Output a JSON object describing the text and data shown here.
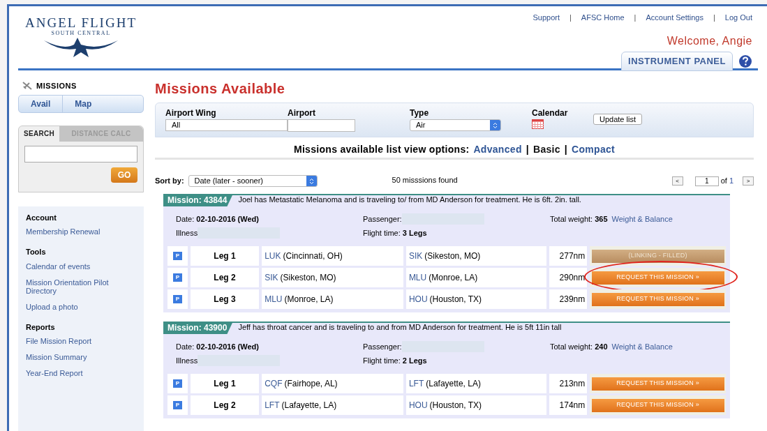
{
  "logo": {
    "title": "ANGEL FLIGHT",
    "subtitle": "SOUTH CENTRAL"
  },
  "top_links": [
    "Support",
    "AFSC Home",
    "Account Settings",
    "Log Out"
  ],
  "top_link_separator": "|",
  "welcome": "Welcome, Angie",
  "instrument_panel": "INSTRUMENT PANEL",
  "sidebar": {
    "heading": "MISSIONS",
    "nav_tabs": [
      {
        "label": "Avail"
      },
      {
        "label": "Map"
      }
    ],
    "search_tabs": [
      {
        "label": "SEARCH",
        "selected": true
      },
      {
        "label": "DISTANCE CALC",
        "selected": false
      }
    ],
    "go": "GO",
    "sections": [
      {
        "heading": "Account",
        "items": [
          "Membership Renewal"
        ]
      },
      {
        "heading": "Tools",
        "items": [
          "Calendar of events",
          "Mission Orientation Pilot Directory",
          "Upload a photo"
        ]
      },
      {
        "heading": "Reports",
        "items": [
          "File Mission Report",
          "Mission Summary",
          "Year-End Report"
        ]
      }
    ]
  },
  "title": "Missions Available",
  "filters": {
    "airport_wing": {
      "label": "Airport Wing",
      "value": "All"
    },
    "airport": {
      "label": "Airport"
    },
    "type": {
      "label": "Type",
      "value": "Air"
    },
    "calendar": {
      "label": "Calendar"
    },
    "update": "Update list"
  },
  "view_options": {
    "label": "Missions available list view options:",
    "separator": "|",
    "options": [
      {
        "label": "Advanced",
        "selected": false
      },
      {
        "label": "Basic",
        "selected": true
      },
      {
        "label": "Compact",
        "selected": false
      }
    ]
  },
  "sort": {
    "label": "Sort by:",
    "value": "Date (later - sooner)"
  },
  "found": "50 misssions found",
  "pager": {
    "prev": "<",
    "page": "1",
    "of": "of",
    "total": "1",
    "next": ">"
  },
  "missions": [
    {
      "title": "Mission: 43844",
      "description": "Joel has Metastatic Melanoma and is traveling to/ from MD Anderson for treatment. He is 6ft. 2in. tall.",
      "date_label": "Date:",
      "date": "02-10-2016 (Wed)",
      "passenger_label": "Passenger:",
      "weight_label": "Total weight:",
      "weight": "365",
      "weight_link": "Weight & Balance",
      "illness_label": "Illness",
      "flight_label": "Flight time:",
      "flight_time": "3 Legs",
      "legs": [
        {
          "badge": "P",
          "label": "Leg 1",
          "from_code": "LUK",
          "from_city": "(Cincinnati, OH)",
          "to_code": "SIK",
          "to_city": "(Sikeston, MO)",
          "distance": "277nm",
          "action": {
            "kind": "filled",
            "label": "(LINKING - FILLED)"
          },
          "highlighted": false
        },
        {
          "badge": "P",
          "label": "Leg 2",
          "from_code": "SIK",
          "from_city": "(Sikeston, MO)",
          "to_code": "MLU",
          "to_city": "(Monroe, LA)",
          "distance": "290nm",
          "action": {
            "kind": "request",
            "label": "REQUEST THIS MISSION »"
          },
          "highlighted": true
        },
        {
          "badge": "P",
          "label": "Leg 3",
          "from_code": "MLU",
          "from_city": "(Monroe, LA)",
          "to_code": "HOU",
          "to_city": "(Houston, TX)",
          "distance": "239nm",
          "action": {
            "kind": "request",
            "label": "REQUEST THIS MISSION »"
          },
          "highlighted": false
        }
      ]
    },
    {
      "title": "Mission: 43900",
      "description": "Jeff has throat cancer and is traveling to and from MD Anderson for treatment. He is 5ft 11in tall",
      "date_label": "Date:",
      "date": "02-10-2016 (Wed)",
      "passenger_label": "Passenger:",
      "weight_label": "Total weight:",
      "weight": "240",
      "weight_link": "Weight & Balance",
      "illness_label": "Illness",
      "flight_label": "Flight time:",
      "flight_time": "2 Legs",
      "legs": [
        {
          "badge": "P",
          "label": "Leg 1",
          "from_code": "CQF",
          "from_city": "(Fairhope, AL)",
          "to_code": "LFT",
          "to_city": "(Lafayette, LA)",
          "distance": "213nm",
          "action": {
            "kind": "request",
            "label": "REQUEST THIS MISSION »"
          },
          "highlighted": false
        },
        {
          "badge": "P",
          "label": "Leg 2",
          "from_code": "LFT",
          "from_city": "(Lafayette, LA)",
          "to_code": "HOU",
          "to_city": "(Houston, TX)",
          "distance": "174nm",
          "action": {
            "kind": "request",
            "label": "REQUEST THIS MISSION »"
          },
          "highlighted": false
        }
      ]
    }
  ]
}
